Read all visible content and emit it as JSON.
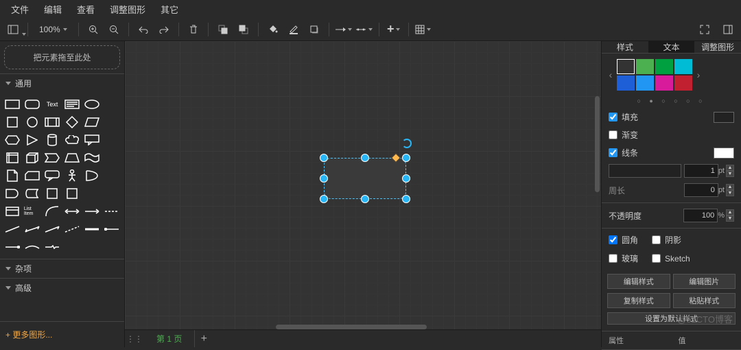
{
  "menu": {
    "file": "文件",
    "edit": "编辑",
    "view": "查看",
    "adjust": "调整图形",
    "other": "其它"
  },
  "toolbar": {
    "zoom": "100%"
  },
  "sidebar": {
    "scratch": "把元素拖至此处",
    "sections": {
      "general": "通用",
      "misc": "杂项",
      "advanced": "高级"
    },
    "more": "+ 更多图形...",
    "textShape": "Text",
    "listItem": "List Item"
  },
  "tabs": {
    "page1": "第 1 页"
  },
  "right": {
    "tabs": {
      "style": "样式",
      "text": "文本",
      "arrange": "调整图形"
    },
    "dots": "○ ● ○ ○ ○ ○",
    "fill": {
      "label": "填充",
      "checked": true
    },
    "gradient": {
      "label": "渐变",
      "checked": false
    },
    "line": {
      "label": "线条",
      "checked": true,
      "width": "1",
      "widthUnit": "pt"
    },
    "perimeter": {
      "label": "周长",
      "value": "0",
      "unit": "pt"
    },
    "opacity": {
      "label": "不透明度",
      "value": "100",
      "unit": "%"
    },
    "rounded": {
      "label": "圆角",
      "checked": true
    },
    "shadow": {
      "label": "阴影",
      "checked": false
    },
    "glass": {
      "label": "玻璃",
      "checked": false
    },
    "sketch": {
      "label": "Sketch",
      "checked": false
    },
    "btns": {
      "editStyle": "编辑样式",
      "editImage": "编辑图片",
      "copyStyle": "复制样式",
      "pasteStyle": "粘贴样式",
      "setDefault": "设置为默认样式"
    },
    "table": {
      "attr": "属性",
      "val": "值"
    }
  },
  "swatches": [
    "#333333",
    "#4caf50",
    "#00a040",
    "#00bcd4",
    "#1e5fd8",
    "#2196f3",
    "#d81b9a",
    "#c02030"
  ],
  "watermark": "@51CTO博客"
}
